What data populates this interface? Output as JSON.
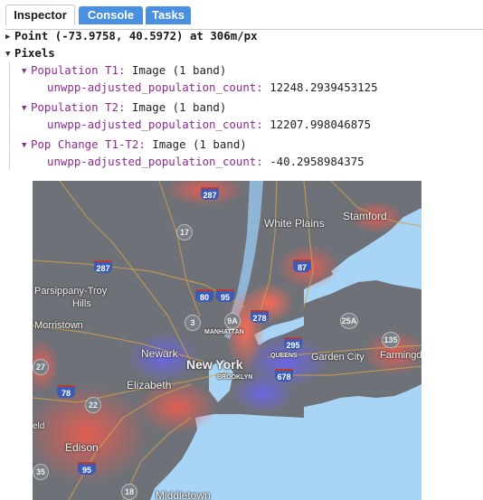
{
  "tabs": [
    {
      "label": "Inspector",
      "active": true
    },
    {
      "label": "Console",
      "active": false
    },
    {
      "label": "Tasks",
      "active": false
    }
  ],
  "point": {
    "label": "Point (-73.9758, 40.5972) at 306m/px"
  },
  "pixels": {
    "label": "Pixels",
    "layers": [
      {
        "name": "Population T1:",
        "type": "Image (1 band)",
        "band": "unwpp-adjusted_population_count:",
        "value": "12248.2939453125"
      },
      {
        "name": "Population T2:",
        "type": "Image (1 band)",
        "band": "unwpp-adjusted_population_count:",
        "value": "12207.998046875"
      },
      {
        "name": "Pop Change T1-T2:",
        "type": "Image (1 band)",
        "band": "unwpp-adjusted_population_count:",
        "value": "-40.2958984375"
      }
    ]
  },
  "map": {
    "colors": {
      "land": "#6e7178",
      "water": "#a8d4f5",
      "increase": "#ff5a4a",
      "decrease": "#6a64f0"
    },
    "places": {
      "white_plains": "White Plains",
      "stamford": "Stamford",
      "parsippany": "Parsippany-Troy",
      "hills": "Hills",
      "morristown": "Morristown",
      "newark": "Newark",
      "new_york": "New York",
      "manhattan": "MANHATTAN",
      "queens": "QUEENS",
      "brooklyn": "BROOKLYN",
      "garden_city": "Garden City",
      "farmingdale": "Farmingda",
      "elizabeth": "Elizabeth",
      "edison": "Edison",
      "middletown": "Middletown",
      "field": "eld"
    },
    "shields": {
      "i287_top": "287",
      "i287_left": "287",
      "r17": "17",
      "i87": "87",
      "i80": "80",
      "i95_top": "95",
      "r9a": "9A",
      "r3": "3",
      "r278": "278",
      "i295": "295",
      "i678": "678",
      "r25a": "25A",
      "r135": "135",
      "i78": "78",
      "r22": "22",
      "i95_bottom": "95",
      "r27": "27",
      "r35": "35",
      "r18": "18"
    }
  }
}
